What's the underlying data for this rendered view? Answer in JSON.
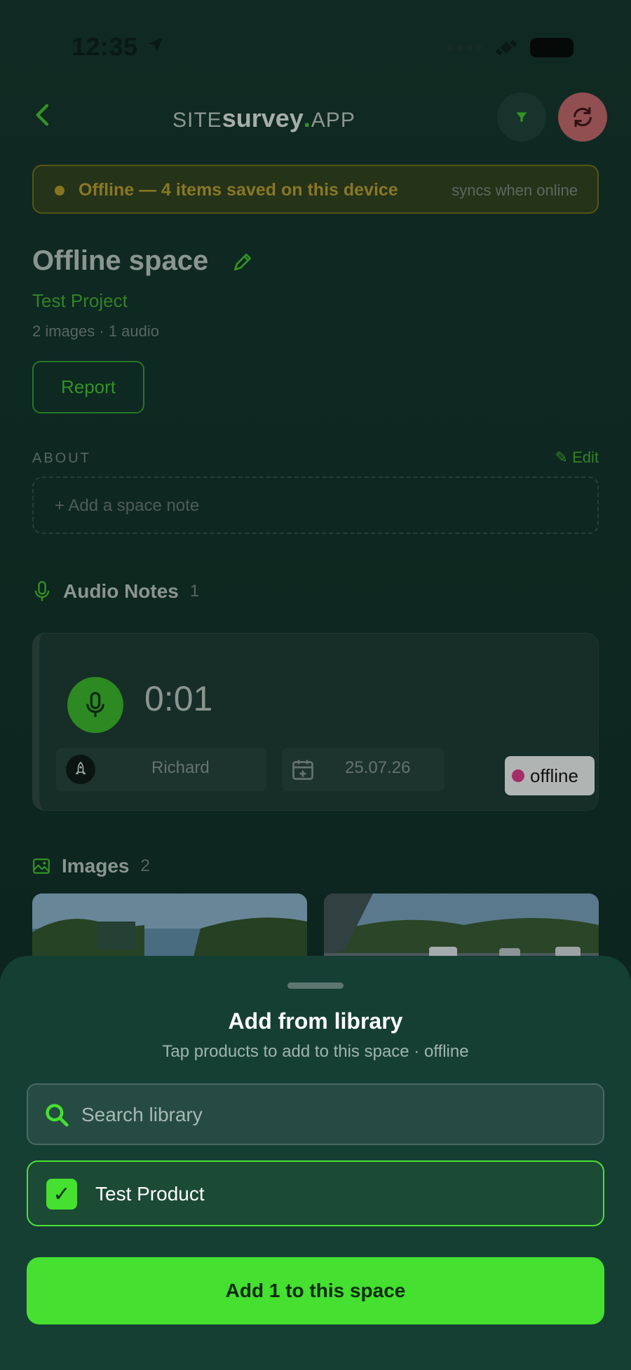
{
  "status_bar": {
    "time": "12:35"
  },
  "header": {
    "logo_site": "SITE",
    "logo_survey": "survey",
    "logo_dot": ".",
    "logo_app": "APP"
  },
  "banner": {
    "message": "Offline — 4 items saved on this device",
    "hint": "syncs when online"
  },
  "space": {
    "title": "Offline space",
    "project": "Test Project",
    "counts": "2 images · 1 audio",
    "report_label": "Report"
  },
  "about": {
    "label": "ABOUT",
    "edit_label": "✎ Edit",
    "note_placeholder": "+ Add a space note"
  },
  "audio": {
    "title": "Audio Notes",
    "count": "1",
    "note": {
      "duration": "0:01",
      "author": "Richard",
      "date": "25.07.26",
      "status": "offline"
    }
  },
  "images": {
    "title": "Images",
    "count": "2"
  },
  "sheet": {
    "title": "Add from library",
    "subtitle": "Tap products to add to this space · offline",
    "search_placeholder": "Search library",
    "products": [
      {
        "name": "Test Product",
        "checked": true
      }
    ],
    "add_button": "Add 1 to this space"
  },
  "colors": {
    "accent": "#45e030",
    "background": "#132f28",
    "sheet": "#163f34",
    "warning": "#a58d2c",
    "sync": "#b05c60"
  }
}
